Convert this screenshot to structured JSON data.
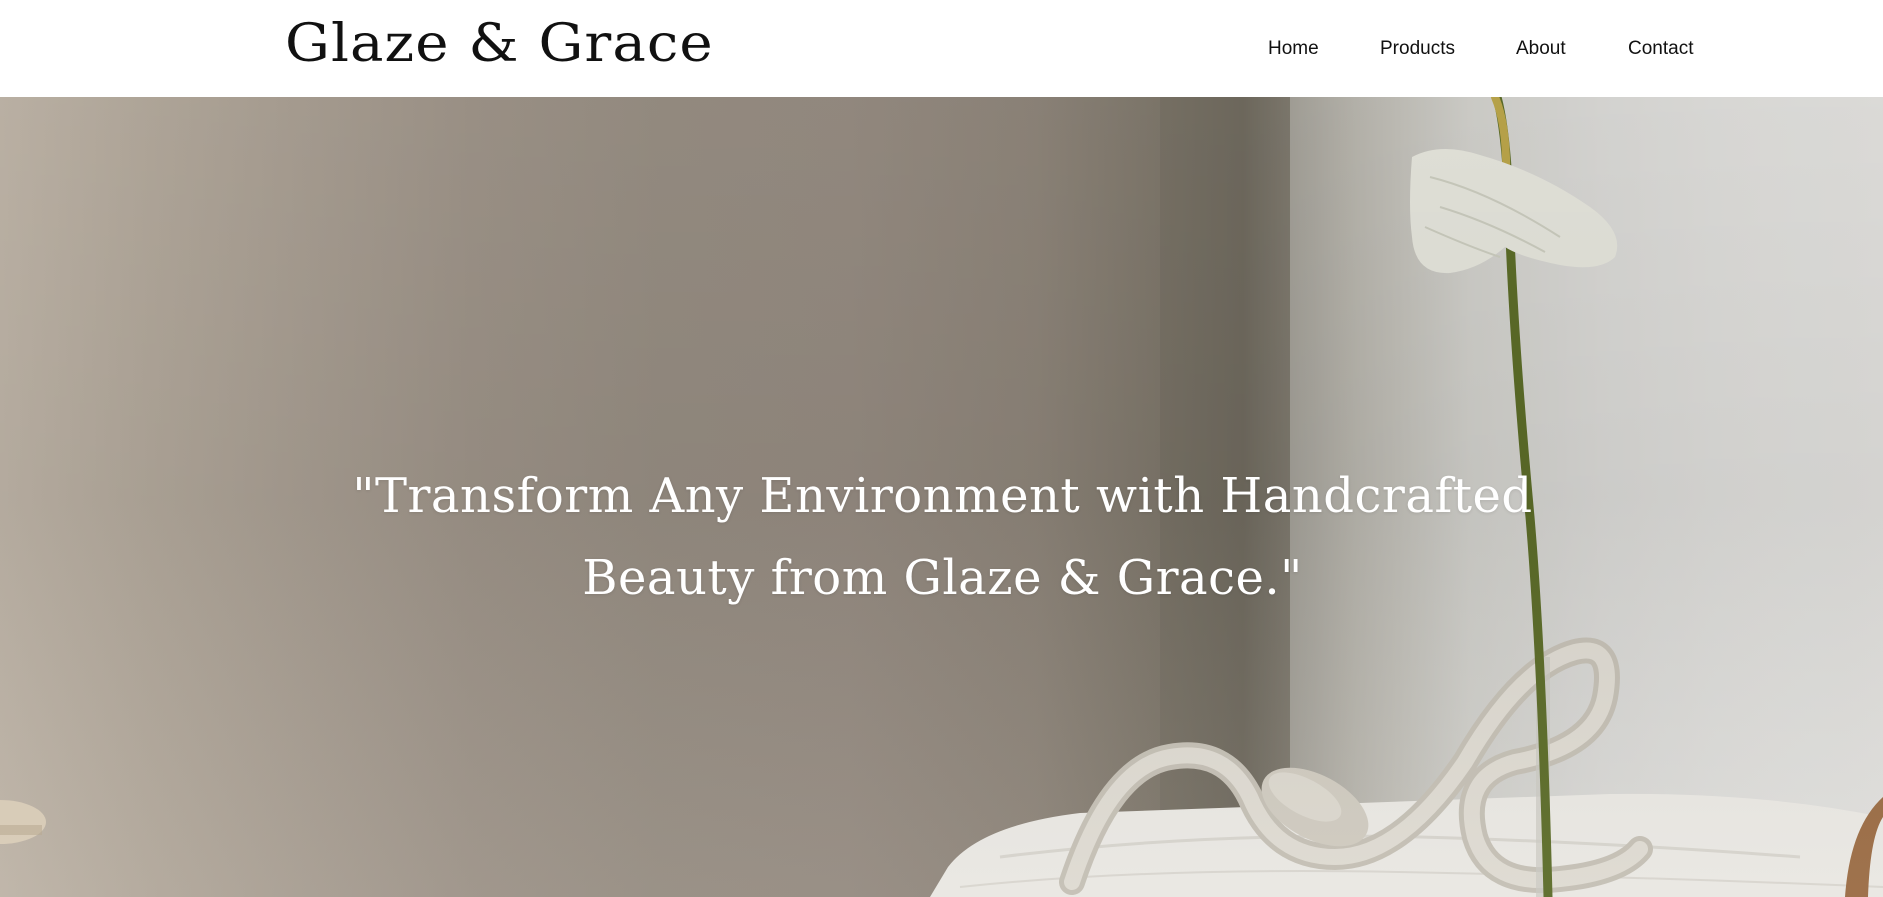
{
  "header": {
    "logo_text": "Glaze & Grace",
    "nav": {
      "home": "Home",
      "products": "Products",
      "about": "About",
      "contact": "Contact"
    }
  },
  "hero": {
    "quote_line1": "\"Transform Any Environment with Handcrafted",
    "quote_line2": "Beauty from Glaze & Grace.\""
  },
  "colors": {
    "header_bg": "#ffffff",
    "nav_text": "#111111",
    "quote_text": "#ffffff",
    "hero_wall": "#9c9287"
  }
}
